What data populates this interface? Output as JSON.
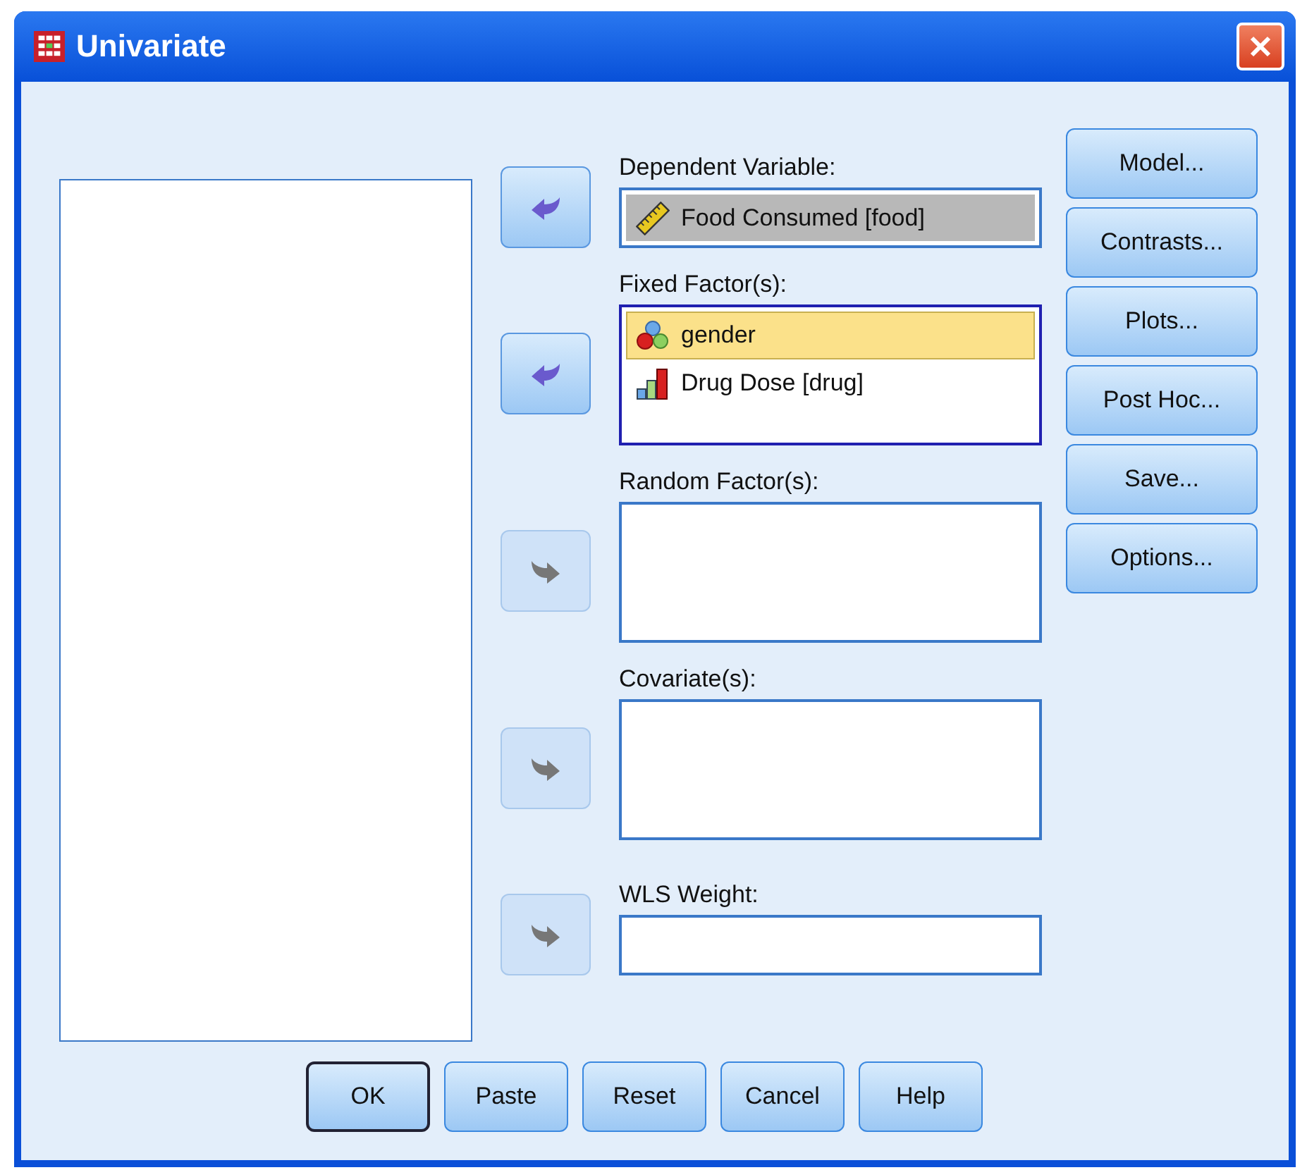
{
  "window": {
    "title": "Univariate"
  },
  "targets": [
    {
      "label": "Dependent Variable:",
      "arrow": {
        "kind": "remove",
        "disabled": false
      },
      "kind": "single",
      "items": [
        {
          "name": "Food Consumed [food]",
          "kind": "scale",
          "selected": true
        }
      ]
    },
    {
      "label": "Fixed Factor(s):",
      "arrow": {
        "kind": "remove",
        "disabled": false
      },
      "kind": "list",
      "focused": true,
      "items": [
        {
          "name": "gender",
          "kind": "nominal",
          "selected": true
        },
        {
          "name": "Drug Dose [drug]",
          "kind": "ordinal",
          "selected": false
        }
      ]
    },
    {
      "label": "Random Factor(s):",
      "arrow": {
        "kind": "add",
        "disabled": true
      },
      "kind": "list",
      "focused": false
    },
    {
      "label": "Covariate(s):",
      "arrow": {
        "kind": "add",
        "disabled": true
      },
      "kind": "list",
      "focused": false
    },
    {
      "label": "WLS Weight:",
      "arrow": {
        "kind": "add",
        "disabled": true
      },
      "kind": "single"
    }
  ],
  "side_buttons": [
    "Model...",
    "Contrasts...",
    "Plots...",
    "Post Hoc...",
    "Save...",
    "Options..."
  ],
  "bottom_buttons": [
    {
      "label": "OK",
      "default": true
    },
    {
      "label": "Paste",
      "default": false
    },
    {
      "label": "Reset",
      "default": false
    },
    {
      "label": "Cancel",
      "default": false
    },
    {
      "label": "Help",
      "default": false
    }
  ]
}
